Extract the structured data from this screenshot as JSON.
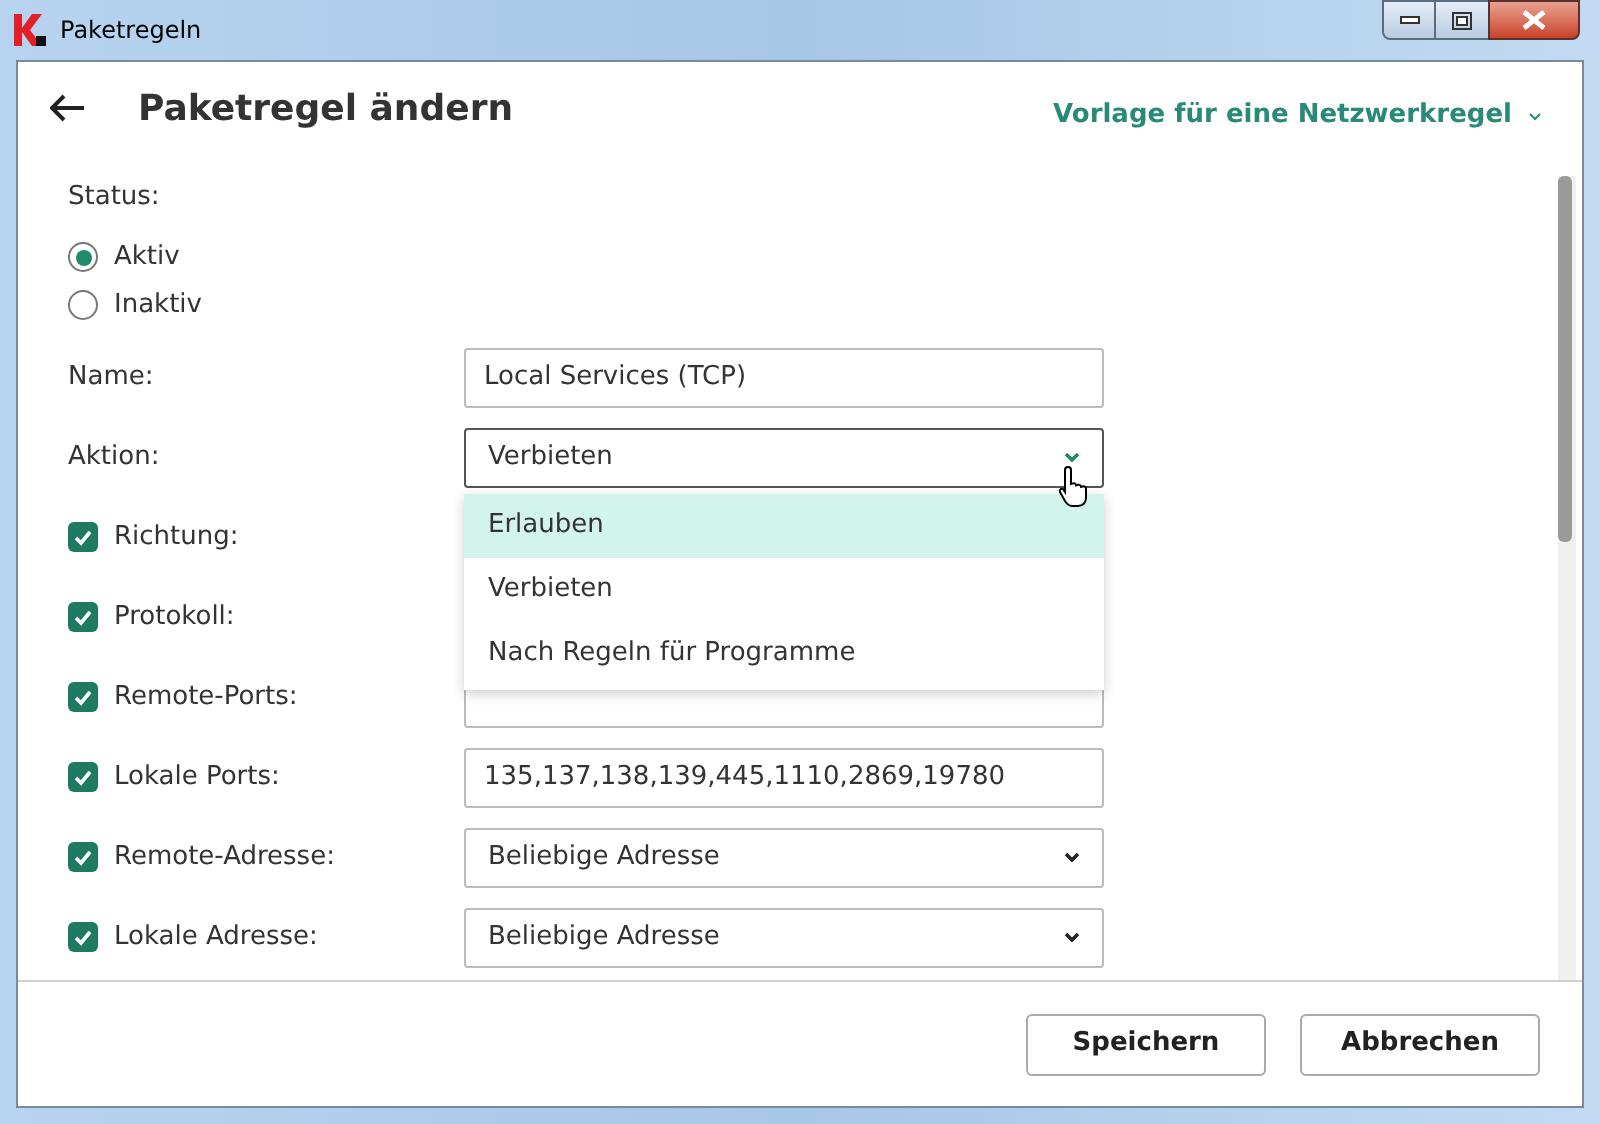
{
  "window": {
    "title": "Paketregeln"
  },
  "header": {
    "title": "Paketregel ändern",
    "template_link": "Vorlage für eine Netzwerkregel"
  },
  "status": {
    "label": "Status:",
    "options": [
      {
        "label": "Aktiv",
        "selected": true
      },
      {
        "label": "Inaktiv",
        "selected": false
      }
    ]
  },
  "fields": [
    {
      "kind": "text",
      "label": "Name:",
      "value": "Local Services (TCP)"
    },
    {
      "kind": "select",
      "label": "Aktion:",
      "value": "Verbieten",
      "open": true,
      "options": [
        {
          "label": "Erlauben",
          "highlighted": true
        },
        {
          "label": "Verbieten",
          "highlighted": false
        },
        {
          "label": "Nach Regeln für Programme",
          "highlighted": false
        }
      ]
    },
    {
      "kind": "covered",
      "label": "Richtung:",
      "checked": true
    },
    {
      "kind": "covered",
      "label": "Protokoll:",
      "checked": true
    },
    {
      "kind": "text",
      "label": "Remote-Ports:",
      "checked": true
    },
    {
      "kind": "text",
      "label": "Lokale Ports:",
      "checked": true,
      "value": "135,137,138,139,445,1110,2869,19780"
    },
    {
      "kind": "select",
      "label": "Remote-Adresse:",
      "checked": true,
      "value": "Beliebige Adresse",
      "open": false
    },
    {
      "kind": "select",
      "label": "Lokale Adresse:",
      "checked": true,
      "value": "Beliebige Adresse",
      "open": false
    }
  ],
  "buttons": [
    {
      "label": "Speichern"
    },
    {
      "label": "Abbrechen"
    }
  ]
}
